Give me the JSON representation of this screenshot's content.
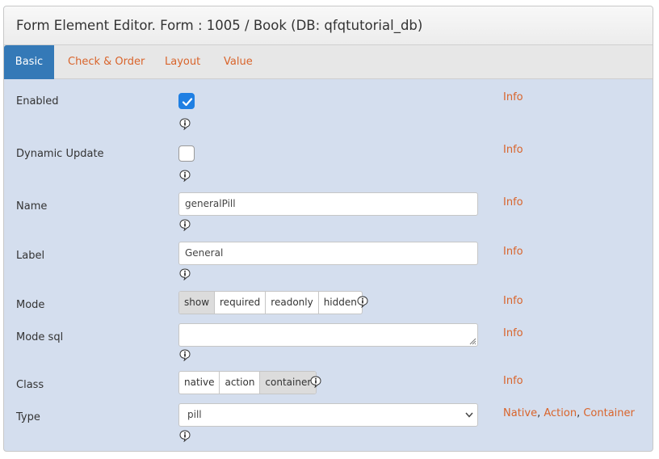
{
  "header": {
    "title": "Form Element Editor. Form : 1005 / Book (DB: qfqtutorial_db)"
  },
  "tabs": [
    {
      "label": "Basic",
      "active": true
    },
    {
      "label": "Check & Order",
      "active": false
    },
    {
      "label": "Layout",
      "active": false
    },
    {
      "label": "Value",
      "active": false
    }
  ],
  "fields": {
    "enabled": {
      "label": "Enabled",
      "checked": true,
      "info": "Info"
    },
    "dynamic_update": {
      "label": "Dynamic Update",
      "checked": false,
      "info": "Info"
    },
    "name": {
      "label": "Name",
      "value": "generalPill",
      "info": "Info"
    },
    "label": {
      "label": "Label",
      "value": "General",
      "info": "Info"
    },
    "mode": {
      "label": "Mode",
      "options": [
        "show",
        "required",
        "readonly",
        "hidden"
      ],
      "selected": "show",
      "info": "Info"
    },
    "mode_sql": {
      "label": "Mode sql",
      "value": "",
      "info": "Info"
    },
    "class": {
      "label": "Class",
      "options": [
        "native",
        "action",
        "container"
      ],
      "selected": "container",
      "info": "Info"
    },
    "type": {
      "label": "Type",
      "value": "pill",
      "info_links": [
        "Native",
        "Action",
        "Container"
      ],
      "info_separator": ", "
    }
  },
  "icons": {
    "info_icon": "info-balloon-icon",
    "checkmark": "checkmark-icon",
    "dropdown": "chevron-down-icon"
  },
  "colors": {
    "panel_body": "#d4deee",
    "active_tab": "#3479b7",
    "link": "#d9642b",
    "checkbox_checked": "#1f7fe3"
  }
}
